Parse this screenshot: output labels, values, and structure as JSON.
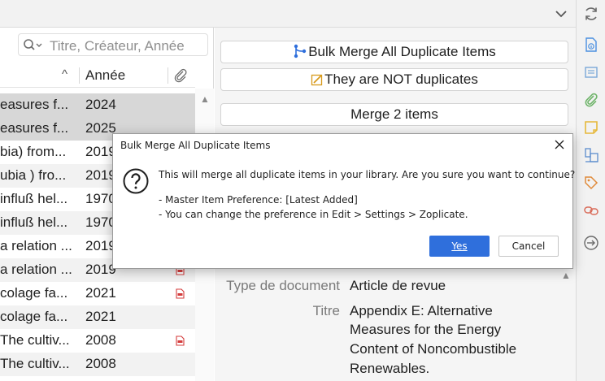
{
  "toolbar": {
    "chevron_icon": "chevron-down-icon"
  },
  "search": {
    "placeholder": "Titre, Créateur, Année",
    "icon": "search-icon"
  },
  "columns": {
    "sort_indicator": "^",
    "year": "Année",
    "attachment_icon": "paperclip-icon"
  },
  "items": [
    {
      "title": "easures f...",
      "year": "2024",
      "state": "selected",
      "pdf": false
    },
    {
      "title": "easures f...",
      "year": "2025",
      "state": "selected",
      "pdf": false
    },
    {
      "title": "bia) from...",
      "year": "2019",
      "state": "even",
      "pdf": false
    },
    {
      "title": "ubia ) fro...",
      "year": "2019",
      "state": "odd",
      "pdf": false
    },
    {
      "title": "influß hel...",
      "year": "1970",
      "state": "even",
      "pdf": false
    },
    {
      "title": "influß hel...",
      "year": "1970",
      "state": "odd",
      "pdf": false
    },
    {
      "title": "a relation ...",
      "year": "2019",
      "state": "even",
      "pdf": false
    },
    {
      "title": "a relation ...",
      "year": "2019",
      "state": "odd",
      "pdf": true
    },
    {
      "title": "colage fa...",
      "year": "2021",
      "state": "even",
      "pdf": true
    },
    {
      "title": "colage fa...",
      "year": "2021",
      "state": "odd",
      "pdf": false
    },
    {
      "title": "The cultiv...",
      "year": "2008",
      "state": "even",
      "pdf": true
    },
    {
      "title": "The cultiv...",
      "year": "2008",
      "state": "odd",
      "pdf": false
    }
  ],
  "actions": {
    "bulk_merge": "Bulk Merge All Duplicate Items",
    "not_duplicates": "They are NOT duplicates",
    "merge": "Merge 2 items"
  },
  "info": {
    "type_label": "Type de document",
    "type_value": "Article de revue",
    "title_label": "Titre",
    "title_line1": "Appendix E: Alternative",
    "title_line2": "Measures for the Energy",
    "title_line3": "Content of Noncombustible",
    "title_line4": "Renewables."
  },
  "dialog": {
    "title": "Bulk Merge All Duplicate Items",
    "message": "This will merge all duplicate items in your library. Are you sure you want to continue?",
    "pref_line": "- Master Item Preference: [Latest Added]",
    "hint_line": "- You can change the preference in Edit > Settings > Zoplicate.",
    "yes": "Yes",
    "cancel": "Cancel",
    "icon": "question-icon",
    "close_icon": "close-icon"
  },
  "sidebar": {
    "icons": [
      "sync-icon",
      "info-icon",
      "abstract-icon",
      "attachments-icon",
      "notes-icon",
      "libraries-icon",
      "tags-icon",
      "related-icon",
      "locate-icon"
    ]
  },
  "colors": {
    "accent": "#2f6fdc",
    "selection": "#d7d7d7",
    "pdf_red": "#d43c3c",
    "tab_icons": [
      "#4a8fe0",
      "#7aa8d8",
      "#6fb46a",
      "#e6b83a",
      "#5b8ccd",
      "#e08a3a",
      "#d96c5a"
    ]
  }
}
